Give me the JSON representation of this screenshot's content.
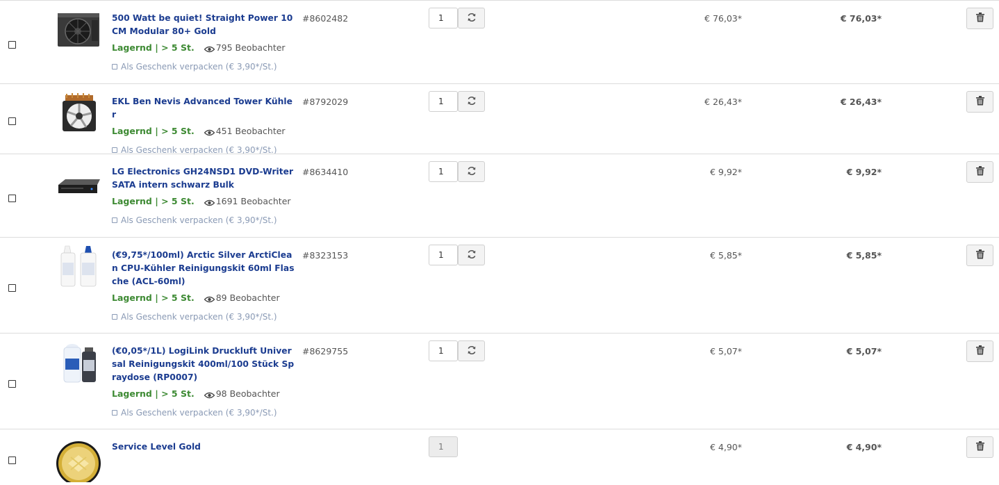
{
  "cart": {
    "items": [
      {
        "title": "500 Watt be quiet! Straight Power 10 CM Modular 80+ Gold",
        "sku": "#8602482",
        "stock": "Lagernd | > 5 St.",
        "watchers": "795 Beobachter",
        "gift": "Als Geschenk verpacken (€ 3,90*/St.)",
        "qty": "1",
        "price": "€ 76,03*",
        "total": "€ 76,03*",
        "icon": "power-supply"
      },
      {
        "title": "EKL Ben Nevis Advanced Tower Kühler",
        "sku": "#8792029",
        "stock": "Lagernd | > 5 St.",
        "watchers": "451 Beobachter",
        "gift": "Als Geschenk verpacken (€ 3,90*/St.)",
        "qty": "1",
        "price": "€ 26,43*",
        "total": "€ 26,43*",
        "icon": "cpu-cooler"
      },
      {
        "title": "LG Electronics GH24NSD1 DVD-Writer SATA intern schwarz Bulk",
        "sku": "#8634410",
        "stock": "Lagernd | > 5 St.",
        "watchers": "1691 Beobachter",
        "gift": "Als Geschenk verpacken (€ 3,90*/St.)",
        "qty": "1",
        "price": "€ 9,92*",
        "total": "€ 9,92*",
        "icon": "dvd-drive"
      },
      {
        "title": "(€9,75*/100ml) Arctic Silver ArctiClean CPU-Kühler Reinigungskit 60ml Flasche (ACL-60ml)",
        "sku": "#8323153",
        "stock": "Lagernd | > 5 St.",
        "watchers": "89 Beobachter",
        "gift": "Als Geschenk verpacken (€ 3,90*/St.)",
        "qty": "1",
        "price": "€ 5,85*",
        "total": "€ 5,85*",
        "icon": "cleaning-bottles"
      },
      {
        "title": "(€0,05*/1L) LogiLink Druckluft Universal Reinigungskit 400ml/100 Stück Spraydose (RP0007)",
        "sku": "#8629755",
        "stock": "Lagernd | > 5 St.",
        "watchers": "98 Beobachter",
        "gift": "Als Geschenk verpacken (€ 3,90*/St.)",
        "qty": "1",
        "price": "€ 5,07*",
        "total": "€ 5,07*",
        "icon": "spray-kit"
      },
      {
        "title": "Service Level Gold",
        "qty": "1",
        "price": "€ 4,90*",
        "total": "€ 4,90*",
        "icon": "service-gold-badge"
      }
    ]
  },
  "colors": {
    "title": "#1b3c90",
    "stock": "#3d8a33",
    "gift": "#8a9ab5",
    "text": "#555555",
    "border": "#dcdcdc"
  }
}
